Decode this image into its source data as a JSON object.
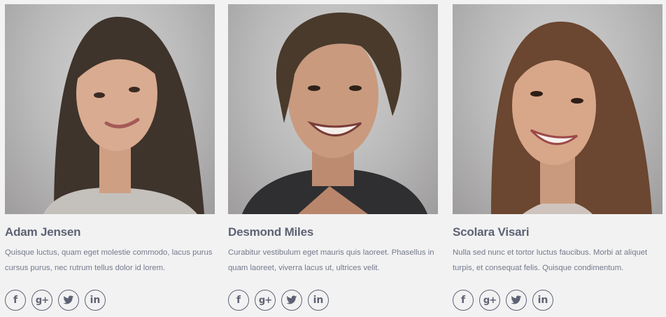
{
  "team": [
    {
      "name": "Adam Jensen",
      "bio": "Quisque luctus, quam eget molestie commodo, lacus purus cursus purus, nec rutrum tellus dolor id lorem.",
      "photo_hair": "#3e342c",
      "photo_skin": "#d9ab90",
      "photo_top": "#c4c0bc"
    },
    {
      "name": "Desmond Miles",
      "bio": "Curabitur vestibulum eget mauris quis laoreet. Phasellus in quam laoreet, viverra lacus ut, ultrices velit.",
      "photo_hair": "#4a3a2c",
      "photo_skin": "#c99a7e",
      "photo_top": "#2f2f31"
    },
    {
      "name": "Scolara Visari",
      "bio": "Nulla sed nunc et tortor luctus faucibus. Morbi at aliquet turpis, et consequat felis. Quisque condimentum.",
      "photo_hair": "#6b4630",
      "photo_skin": "#d8a78a",
      "photo_top": "#cfc4bd"
    }
  ],
  "social_icons": {
    "facebook": "f",
    "googleplus": "g+",
    "twitter": "🐦",
    "linkedin": "in"
  },
  "colors": {
    "background": "#f2f2f3",
    "name_text": "#5e6273",
    "body_text": "#757a8b",
    "icon": "#5f6273"
  }
}
